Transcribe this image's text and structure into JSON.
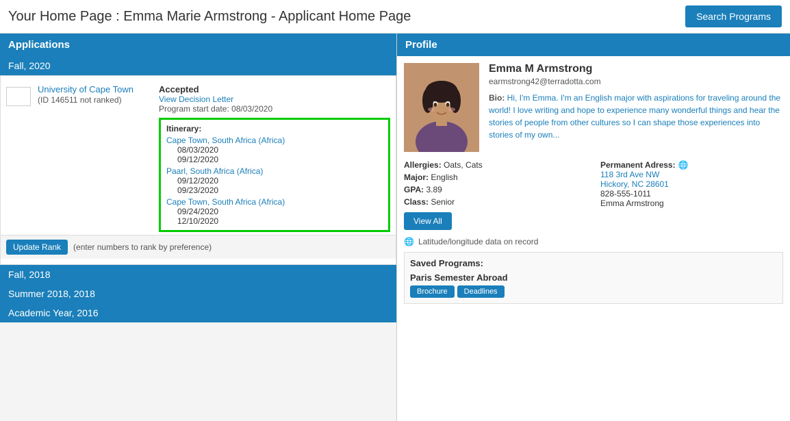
{
  "header": {
    "title": "Your Home Page : Emma Marie Armstrong - Applicant Home Page",
    "search_btn": "Search Programs"
  },
  "left": {
    "section_title": "Applications",
    "terms": [
      {
        "label": "Fall, 2020",
        "applications": [
          {
            "rank": "",
            "name": "University of Cape Town",
            "id_text": "(ID 146511 not ranked)",
            "status": "Accepted",
            "decision_link": "View Decision Letter",
            "start_label": "Program start date:",
            "start_date": "08/03/2020",
            "itinerary": {
              "title": "Itinerary:",
              "locations": [
                {
                  "name": "Cape Town, South Africa (Africa)",
                  "dates": [
                    "08/03/2020",
                    "09/12/2020"
                  ]
                },
                {
                  "name": "Paarl, South Africa (Africa)",
                  "dates": [
                    "09/12/2020",
                    "09/23/2020"
                  ]
                },
                {
                  "name": "Cape Town, South Africa (Africa)",
                  "dates": [
                    "09/24/2020",
                    "12/10/2020"
                  ]
                }
              ]
            }
          }
        ],
        "update_rank_btn": "Update Rank",
        "rank_hint": "(enter numbers to rank by preference)"
      },
      {
        "label": "Fall, 2018",
        "applications": []
      },
      {
        "label": "Summer 2018, 2018",
        "applications": []
      },
      {
        "label": "Academic Year, 2016",
        "applications": []
      }
    ]
  },
  "right": {
    "section_title": "Profile",
    "user": {
      "name": "Emma M Armstrong",
      "email": "earmstrong42@terradotta.com",
      "bio_prefix": "Bio:",
      "bio_text": " Hi, I'm Emma. I'm an English major with aspirations for traveling around the world! I love writing and hope to experience many wonderful things and hear the stories of people from other cultures so I can shape those experiences into stories of my own..."
    },
    "details": {
      "allergies_label": "Allergies:",
      "allergies_value": "Oats, Cats",
      "major_label": "Major:",
      "major_value": "English",
      "gpa_label": "GPA:",
      "gpa_value": "3.89",
      "class_label": "Class:",
      "class_value": "Senior"
    },
    "address": {
      "title": "Permanent Adress:",
      "line1": "118 3rd Ave NW",
      "line2": "Hickory, NC 28601",
      "phone": "828-555-1011",
      "name": "Emma Armstrong"
    },
    "view_all_btn": "View All",
    "lat_long": "Latitude/longitude data on record",
    "saved_programs": {
      "title": "Saved Programs:",
      "items": [
        {
          "name": "Paris Semester Abroad",
          "brochure_btn": "Brochure",
          "deadlines_btn": "Deadlines"
        }
      ]
    }
  }
}
